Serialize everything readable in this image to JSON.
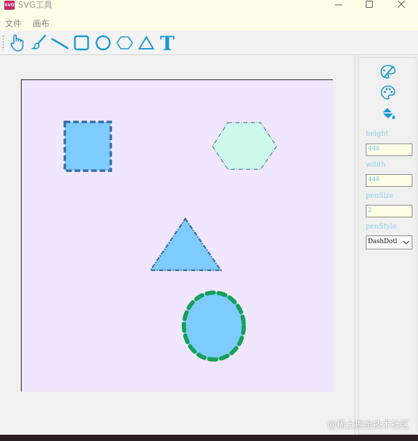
{
  "window": {
    "title": "SVG工具",
    "icon_label": "SVG",
    "controls": [
      "minimize-icon",
      "maximize-icon",
      "close-icon"
    ]
  },
  "menu": {
    "items": [
      {
        "label": "文件"
      },
      {
        "label": "画布"
      }
    ]
  },
  "toolbar": {
    "tools": [
      {
        "name": "hand-tool",
        "icon": "hand-pointer-icon"
      },
      {
        "name": "brush-tool",
        "icon": "brush-icon"
      },
      {
        "name": "line-tool",
        "icon": "line-icon"
      },
      {
        "name": "rectangle-tool",
        "icon": "square-icon"
      },
      {
        "name": "ellipse-tool",
        "icon": "circle-icon"
      },
      {
        "name": "hexagon-tool",
        "icon": "hexagon-icon"
      },
      {
        "name": "triangle-tool",
        "icon": "triangle-icon"
      },
      {
        "name": "text-tool",
        "icon": "text-T-icon",
        "glyph": "T"
      }
    ],
    "icon_color": "#1a97d6"
  },
  "canvas": {
    "background": "#f0e6fe",
    "shapes": [
      {
        "kind": "rectangle",
        "fill": "#7ecbff",
        "stroke": "#3a6ea0",
        "stroke_style": "dash"
      },
      {
        "kind": "hexagon",
        "fill": "#cdfaeb",
        "stroke": "#5b7a9a",
        "stroke_style": "dashdot"
      },
      {
        "kind": "triangle",
        "fill": "#7ecbff",
        "stroke": "#3a6ea0",
        "stroke_style": "dashdot"
      },
      {
        "kind": "ellipse",
        "fill": "#7ecbff",
        "stroke": "#16a05a",
        "stroke_style": "dash"
      }
    ]
  },
  "properties": {
    "tools": [
      {
        "name": "stroke-color-tool",
        "icon": "palette-pen-icon"
      },
      {
        "name": "palette-tool",
        "icon": "palette-icon"
      },
      {
        "name": "fill-bucket-tool",
        "icon": "paint-bucket-icon"
      }
    ],
    "height_label": "height",
    "height_value": "448",
    "width_label": "wdith",
    "width_value": "448",
    "pensize_label": "penSize",
    "pensize_value": "2",
    "penstyle_label": "penStyle",
    "penstyle_value": "DashDotl"
  },
  "watermark": "@稀土掘金技术社区"
}
